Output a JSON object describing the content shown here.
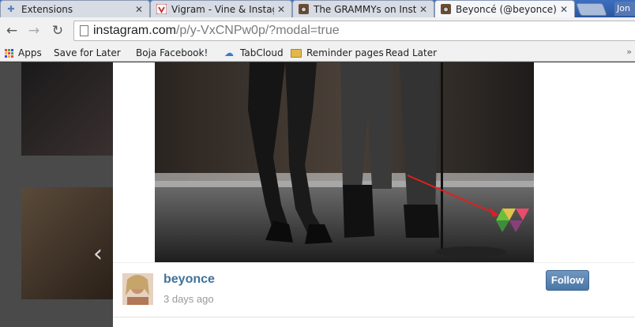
{
  "tabs": [
    {
      "label": "Extensions",
      "icon": "puzzle-icon",
      "active": false
    },
    {
      "label": "Vigram - Vine & Instagr",
      "icon": "vigram-icon",
      "active": false
    },
    {
      "label": "The GRAMMYs on Insta",
      "icon": "instagram-icon",
      "active": false
    },
    {
      "label": "Beyoncé (@beyonce) •",
      "icon": "instagram-icon",
      "active": true
    }
  ],
  "profile": {
    "label": "Jon"
  },
  "toolbar": {
    "back_icon": "back-arrow-icon",
    "forward_icon": "forward-arrow-icon",
    "reload_icon": "reload-icon",
    "url_host": "instagram.com",
    "url_path": "/p/y-VxCNPw0p/?modal=true"
  },
  "bookmarks": [
    {
      "label": "Apps",
      "icon": "apps-icon"
    },
    {
      "label": "Save for Later",
      "icon": "page-icon"
    },
    {
      "label": "Boja Facebook!",
      "icon": "page-icon"
    },
    {
      "label": "TabCloud",
      "icon": "cloud-icon"
    },
    {
      "label": "Reminder pages",
      "icon": "folder-icon"
    },
    {
      "label": "Read Later",
      "icon": "page-icon"
    }
  ],
  "post": {
    "username": "beyonce",
    "time": "3 days ago",
    "follow_label": "Follow"
  },
  "nav_arrows": {
    "prev": "‹",
    "next": "›"
  },
  "colors": {
    "instagram_blue": "#3f729b",
    "follow_button": "#5b86b4",
    "arrow_annotation": "#e01f1f"
  }
}
